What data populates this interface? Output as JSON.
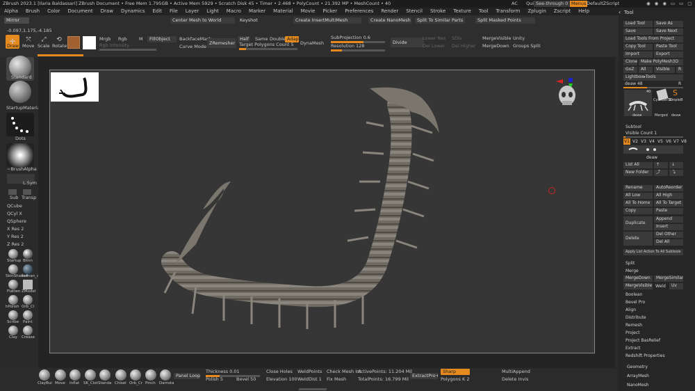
{
  "titlebar": {
    "text": "ZBrush 2023.1 [Ilaria Baldassari]   ZBrush Document   • Free Mem 1.795GB • Active Mem 5929 • Scratch Disk 45 • Timer • 2.468 • PolyCount • 21.392 MP • MeshCount • 40",
    "ac": "AC",
    "quicksave": "QuickSave",
    "seethrough": "See-through  0",
    "menus_label": "Menus",
    "script": "DefaultZScript"
  },
  "menu": [
    "Alpha",
    "Brush",
    "Color",
    "Document",
    "Draw",
    "Dynamics",
    "Edit",
    "File",
    "Layer",
    "Light",
    "Macro",
    "Marker",
    "Material",
    "Movie",
    "Picker",
    "Preferences",
    "Render",
    "Stencil",
    "Stroke",
    "Texture",
    "Tool",
    "Transform",
    "Zplugin",
    "Zscript",
    "Help"
  ],
  "toolbar": {
    "mirror": "Mirror",
    "center_mesh": "Center Mesh to World",
    "keyshot": "Keyshot",
    "create_insert": "Create InsertMultiMesh",
    "create_nano": "Create NanoMesh Brush",
    "split_similar": "Split To Similar Parts",
    "split_masked": "Split Masked Points",
    "coords": "-0.097,1.175,-4.185",
    "draw": "Draw",
    "move": "Move",
    "scale": "Scale",
    "rotate": "Rotate",
    "mrgb": "Mrgb",
    "rgb": "Rgb",
    "m": "M",
    "rgb_intensity": "Rgb Intensity",
    "fill_object": "FillObject",
    "backface": "BackfaceMask",
    "curve_mode": "Curve Mode",
    "zremesher": "ZRemesher",
    "half": "Half",
    "same": "Same",
    "double": "Double",
    "adapt": "Adapt",
    "target_polys": "Target Polygons Count 5",
    "dynamesh": "DynaMesh",
    "subprojection": "SubProjection 0.6",
    "resolution": "Resolution 128",
    "divide": "Divide",
    "lower_res": "Lower Res",
    "del_lower": "Del Lower",
    "sdiv": "SDiv",
    "higher_res": "Del Higher",
    "merge_visible": "MergeVisible",
    "merge_down": "MergeDown",
    "unity": "Unity",
    "groups_split": "Groups Split"
  },
  "leftbar": {
    "standard": "Standard",
    "startup_material": "StartupMateria",
    "dots": "Dots",
    "brush_alpha": "~BrushAlpha",
    "lsym": "L.Sym",
    "sub": "Sub",
    "transp": "Transp",
    "qcube": "QCube",
    "qcyl": "QCyl X",
    "qsphere": "QSphere",
    "xres": "X Res 2",
    "yres": "Y Res 2",
    "zres": "Z Res 2",
    "thumbs": [
      "Startup",
      "Blinn",
      "SkinShade4",
      "human_di",
      "Flatten",
      "ZModel",
      "hPolish",
      "Orb_Cl",
      "Scribe",
      "Paint",
      "Clay",
      "Crease"
    ]
  },
  "rightpanel": {
    "tool_title": "Tool",
    "load_tool": "Load Tool",
    "save_as": "Save As",
    "save": "Save",
    "save_next": "Save Next",
    "load_tools_project": "Load Tools From Project",
    "copy_tool": "Copy Tool",
    "paste_tool": "Paste Tool",
    "import": "Import",
    "export": "Export",
    "clone": "Clone",
    "make_polymesh": "Make PolyMesh3D",
    "goz": "GoZ",
    "all": "All",
    "visible": "Visible",
    "r": "R",
    "lightbox_tools": "Lightbox▸Tools",
    "deaw_slider": "deaw  48",
    "r2": "R",
    "tool_count": "40",
    "tool_names": [
      "deaw",
      "Cylinder3D",
      "SimpleB",
      "Merged",
      "deaw"
    ],
    "subtool": "Subtool",
    "visible_count": "Visible Count 1",
    "v_labels": [
      "V1",
      "V2",
      "V3",
      "V4",
      "V5",
      "V6",
      "V7",
      "V8"
    ],
    "subtool_name": "deaw",
    "list_all": "List All",
    "new_folder": "New Folder",
    "rename": "Rename",
    "autoreorder": "AutoReorder",
    "all_low": "All Low",
    "all_high": "All High",
    "all_to_home": "All To Home",
    "all_to_target": "All To Target",
    "copy": "Copy",
    "paste": "Paste",
    "duplicate": "Duplicate",
    "append": "Append",
    "insert": "Insert",
    "delete": "Delete",
    "del_other": "Del Other",
    "del_all": "Del All",
    "apply_list": "Apply List Action To All Subtools",
    "split": "Split",
    "merge": "Merge",
    "merge_down": "MergeDown",
    "merge_similar": "MergeSimilar",
    "merge_visible": "MergeVisible",
    "weld": "Weld",
    "uv": "Uv",
    "boolean": "Boolean",
    "bevel_pro": "Bevel Pro",
    "align": "Align",
    "distribute": "Distribute",
    "remesh": "Remesh",
    "project": "Project",
    "project_bas": "Project BasRelief",
    "extract": "Extract",
    "redshift": "Redshift Properties",
    "geometry": "Geometry",
    "arraymesh": "ArrayMesh",
    "nanomesh": "NanoMesh"
  },
  "bottombar": {
    "brushes": [
      "ClayBui",
      "Move",
      "Inflat",
      "SK_Clot",
      "Standa",
      "Chisel",
      "Orb_Cr",
      "Pinch",
      "Damsta"
    ],
    "panel_loops": "Panel Loops",
    "thickness": "Thickness 0.01",
    "polish": "Polish 5",
    "bevel": "Bevel 50",
    "close_holes": "Close Holes",
    "elevation": "Elevation 100",
    "weld_points": "WeldPoints",
    "weld_dist": "WeldDist 1",
    "check_mesh": "Check Mesh Int",
    "fix_mesh": "Fix Mesh",
    "active_points": "ActivePoints: 11.204 Mil",
    "total_points": "TotalPoints: 16.799 Mil",
    "extract_pro": "ExtractPro+",
    "sharp": "Sharp",
    "polygons_k": "Polygons K 2",
    "multi_append": "MultiAppend",
    "delete_invis": "Delete Invis"
  },
  "colors": {
    "accent": "#e58a1f",
    "bg": "#2b2b2b",
    "viewport": "#363636"
  }
}
